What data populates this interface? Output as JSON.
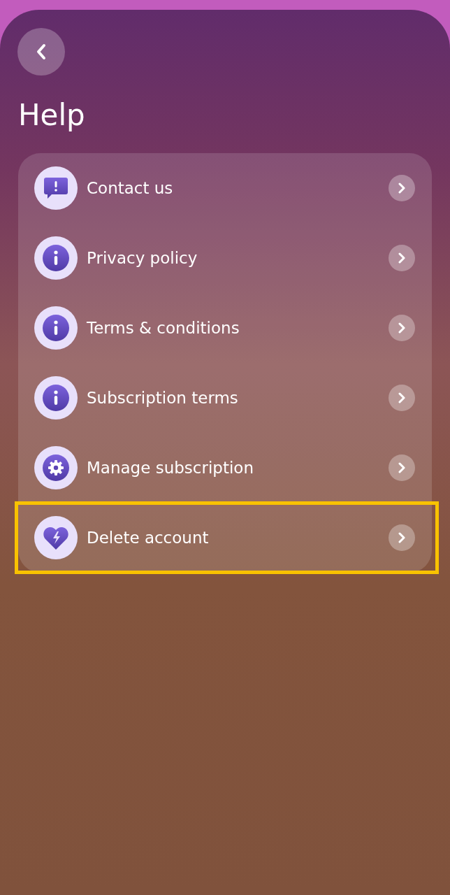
{
  "title": "Help",
  "items": [
    {
      "label": "Contact us",
      "kind": "message",
      "highlighted": false
    },
    {
      "label": "Privacy policy",
      "kind": "info",
      "highlighted": false
    },
    {
      "label": "Terms & conditions",
      "kind": "info",
      "highlighted": false
    },
    {
      "label": "Subscription terms",
      "kind": "info",
      "highlighted": false
    },
    {
      "label": "Manage subscription",
      "kind": "gear",
      "highlighted": false
    },
    {
      "label": "Delete account",
      "kind": "heart",
      "highlighted": true
    }
  ]
}
